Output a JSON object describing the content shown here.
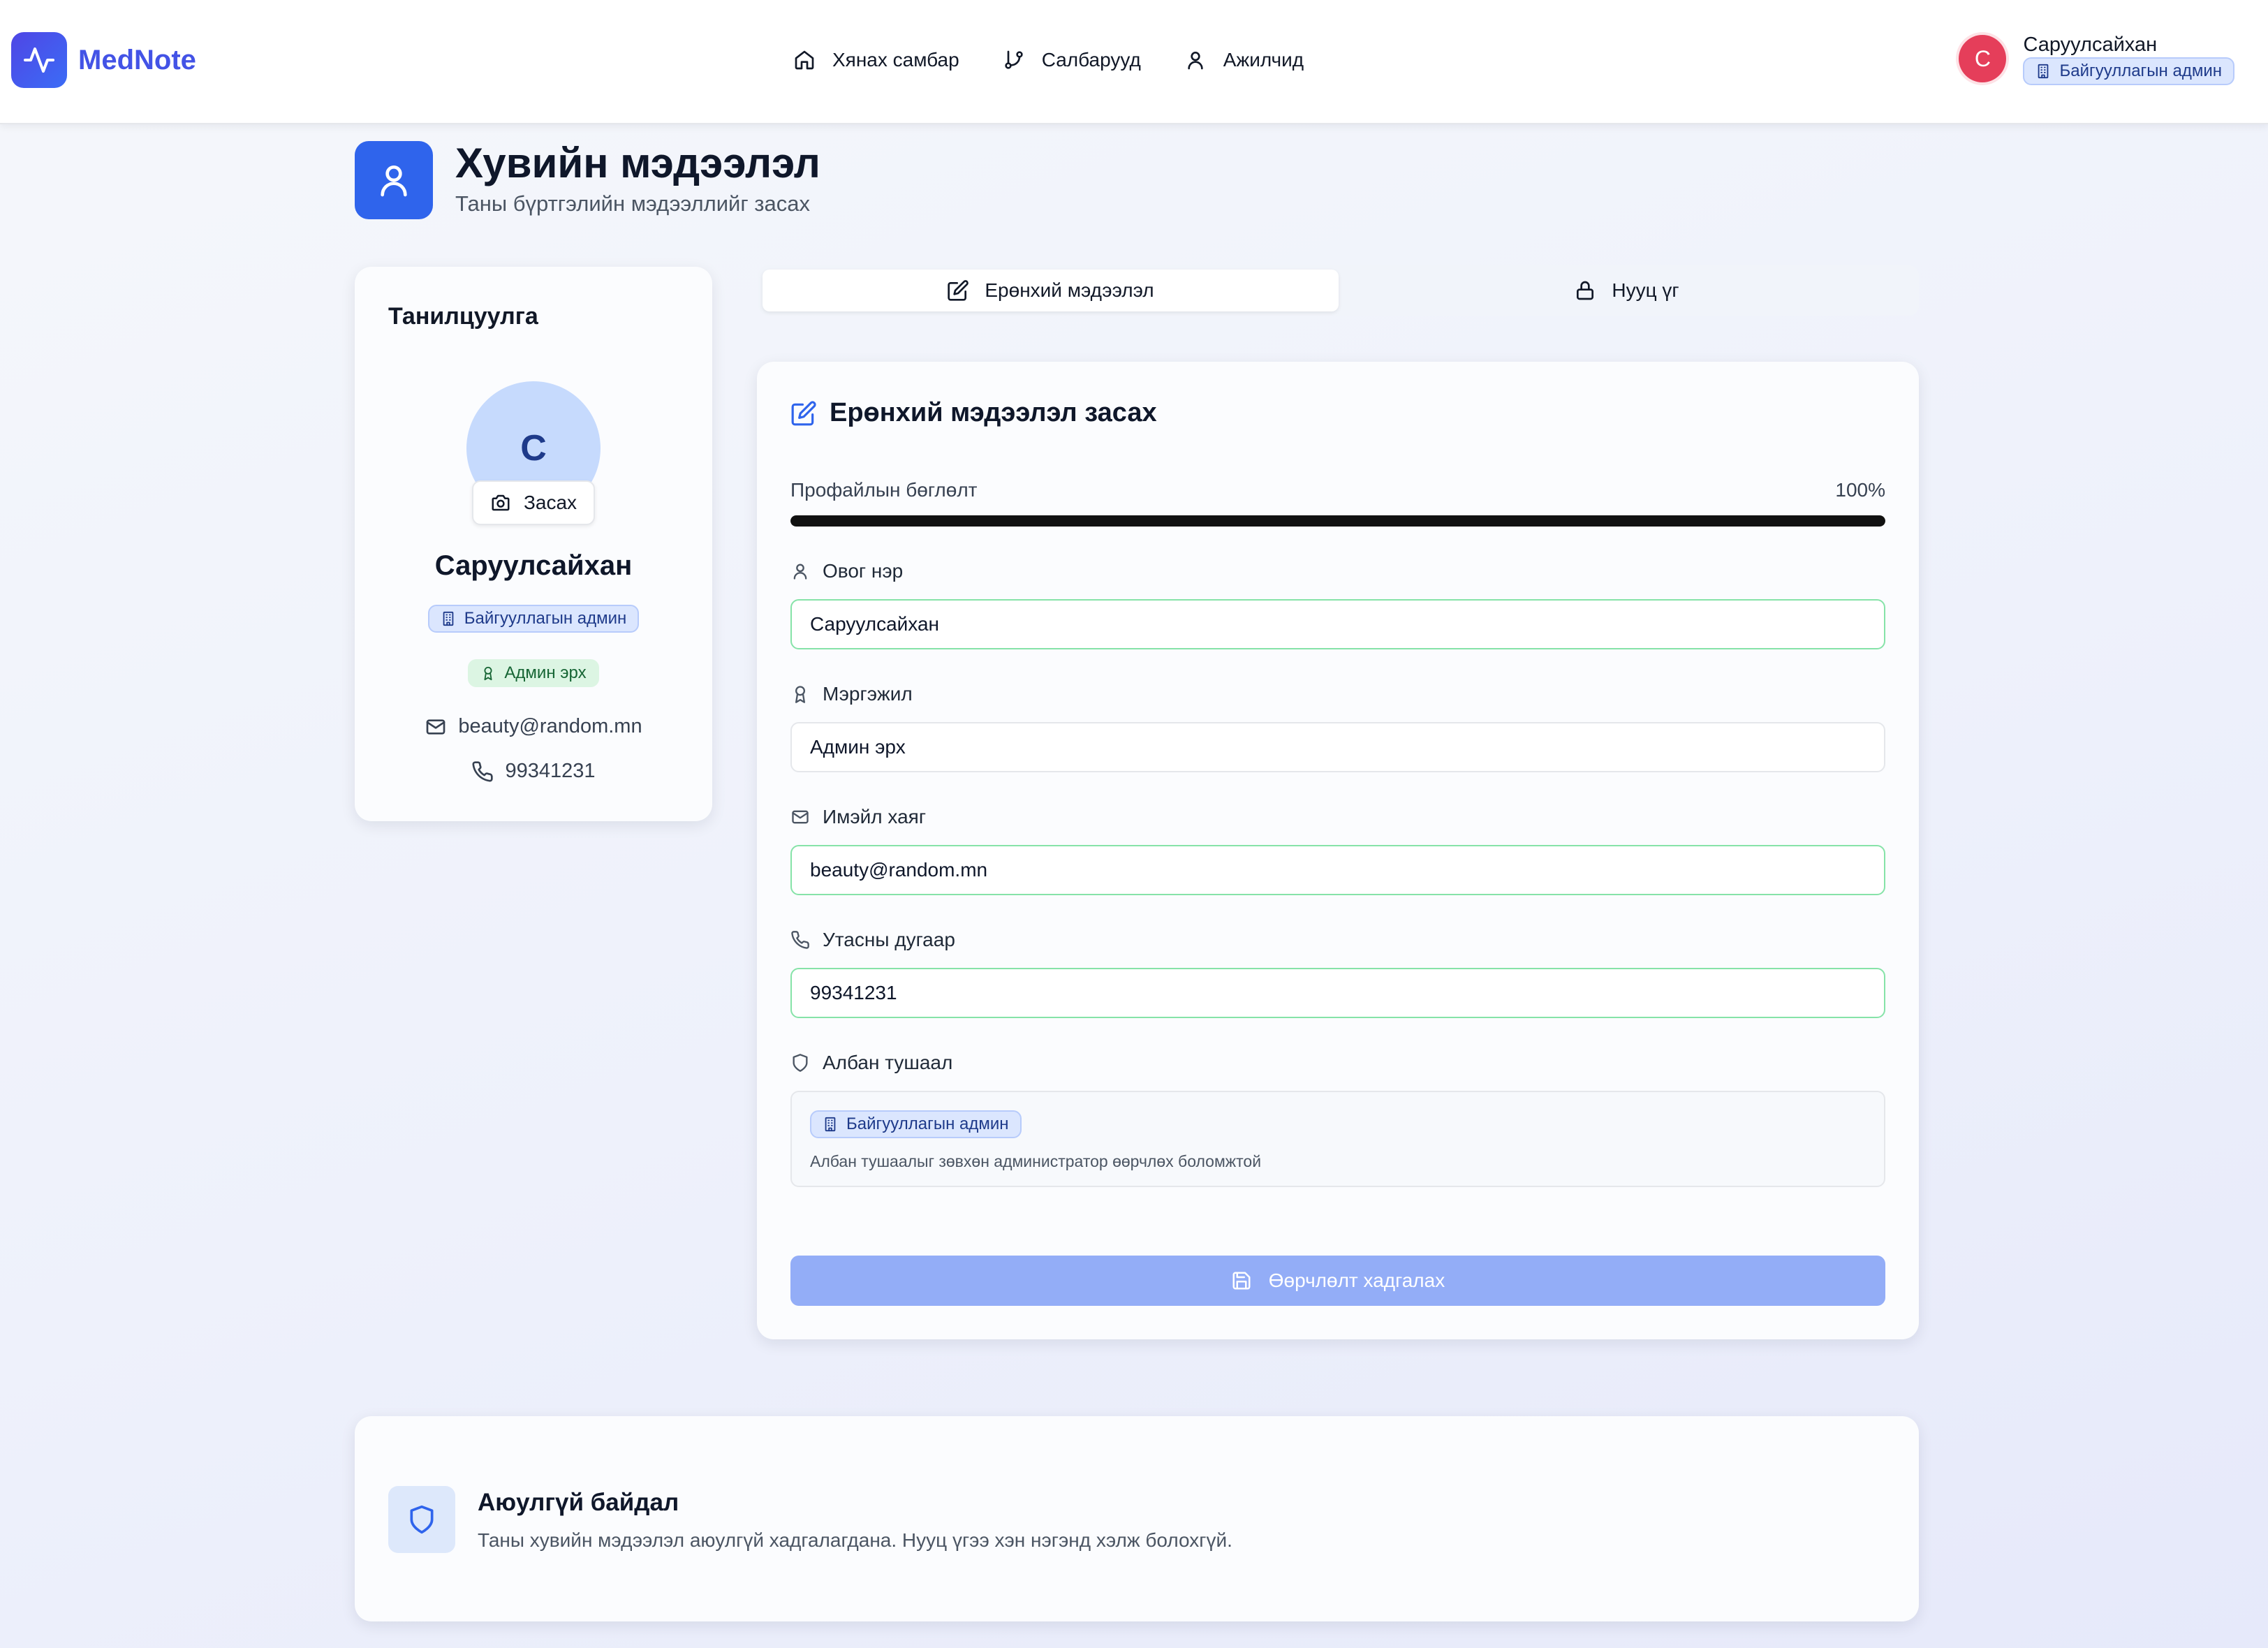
{
  "app": {
    "name": "MedNote"
  },
  "nav": {
    "items": [
      {
        "label": "Хянах самбар",
        "icon": "home-icon"
      },
      {
        "label": "Салбарууд",
        "icon": "branch-icon"
      },
      {
        "label": "Ажилчид",
        "icon": "user-icon"
      }
    ]
  },
  "user": {
    "initial": "C",
    "name": "Саруулсайхан",
    "role": "Байгууллагын админ"
  },
  "page": {
    "title": "Хувийн мэдээлэл",
    "subtitle": "Таны бүртгэлийн мэдээллийг засах"
  },
  "profile_card": {
    "title": "Танилцуулга",
    "avatar_initial": "C",
    "edit_label": "Засах",
    "name": "Саруулсайхан",
    "role_badge": "Байгууллагын админ",
    "permission_badge": "Админ эрх",
    "email": "beauty@random.mn",
    "phone": "99341231"
  },
  "tabs": [
    {
      "label": "Ерөнхий мэдээлэл",
      "icon": "edit-icon",
      "active": true
    },
    {
      "label": "Нууц үг",
      "icon": "lock-icon",
      "active": false
    }
  ],
  "form": {
    "title": "Ерөнхий мэдээлэл засах",
    "progress": {
      "label": "Профайлын бөглөлт",
      "value_text": "100%",
      "value": 100
    },
    "fields": {
      "name": {
        "label": "Овог нэр",
        "value": "Саруулсайхан"
      },
      "profession": {
        "label": "Мэргэжил",
        "value": "Админ эрх"
      },
      "email": {
        "label": "Имэйл хаяг",
        "value": "beauty@random.mn"
      },
      "phone": {
        "label": "Утасны дугаар",
        "value": "99341231"
      }
    },
    "position": {
      "label": "Албан тушаал",
      "badge": "Байгууллагын админ",
      "note": "Албан тушаалыг зөвхөн администратор өөрчлөх боломжтой"
    },
    "save_label": "Өөрчлөлт хадгалах"
  },
  "security": {
    "title": "Аюулгүй байдал",
    "text": "Таны хувийн мэдээлэл аюулгүй хадгалагдана. Нууц үгээ хэн нэгэнд хэлж болохгүй."
  },
  "colors": {
    "brand": "#4353e6",
    "primary": "#2f64ec",
    "avatar_red": "#e53e5a",
    "success_border": "#86e3a8",
    "save_disabled": "#93adf7"
  }
}
